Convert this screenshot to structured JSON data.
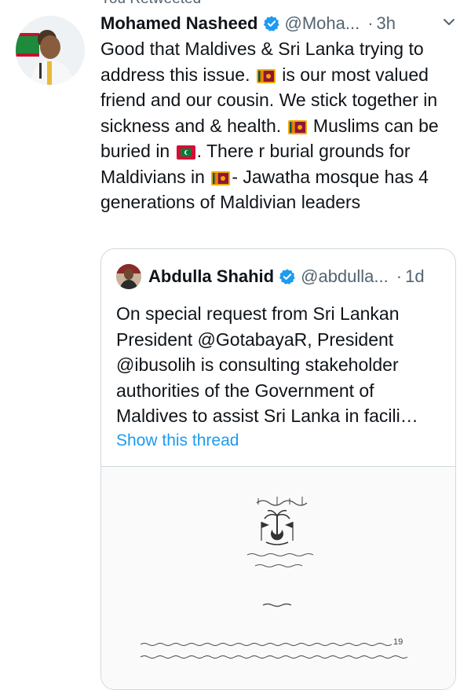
{
  "retweet_header": "You Retweeted",
  "tweet": {
    "author_name": "Mohamed Nasheed",
    "author_handle": "@Moha...",
    "separator": "·",
    "time": "3h",
    "text_parts": {
      "p1": "Good that Maldives & Sri Lanka trying to address this issue.",
      "p2": "is our most valued friend and our cousin. We stick together in sickness and & health.",
      "p3": "Muslims can be buried in",
      "p4": ". There r burial grounds for Maldivians in",
      "p5": "- Jawatha mosque has 4 generations of Maldivian leaders"
    }
  },
  "quoted_tweet": {
    "author_name": "Abdulla Shahid",
    "author_handle": "@abdulla...",
    "separator": "·",
    "time": "1d",
    "text": "On special request from Sri Lankan President @GotabayaR, President @ibusolih is consulting stakeholder authorities of the Government of Maldives to assist Sri Lanka in facili…",
    "show_thread": "Show this thread",
    "media_number": "19"
  },
  "colors": {
    "accent": "#1d9bf0",
    "verified": "#1d9bf0",
    "secondary_text": "#536471",
    "border": "#cfd9de"
  },
  "icons": {
    "verified": "verified-badge-icon",
    "menu": "chevron-down-icon",
    "flag_sri_lanka": "sri-lanka-flag-emoji",
    "flag_maldives": "maldives-flag-emoji"
  }
}
